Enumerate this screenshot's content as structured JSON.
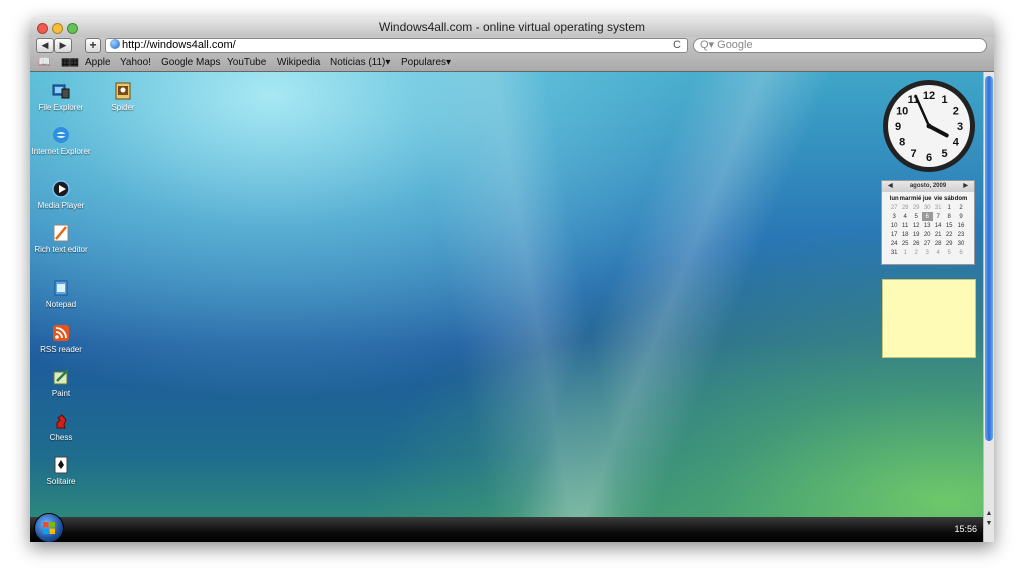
{
  "window": {
    "title": "Windows4all.com - online virtual operating system"
  },
  "toolbar": {
    "back_label": "◀",
    "forward_label": "▶",
    "add_label": "+",
    "url": "http://windows4all.com/",
    "reload_label": "C",
    "search_placeholder": "Q▾ Google"
  },
  "bookmarks": {
    "items": [
      "Apple",
      "Yahoo!",
      "Google Maps",
      "YouTube",
      "Wikipedia",
      "Noticias (11)▾",
      "Populares▾"
    ]
  },
  "desktop": {
    "icons": [
      {
        "label": "File Explorer",
        "icon": "file-explorer-icon"
      },
      {
        "label": "Spider",
        "icon": "spider-solitaire-icon"
      },
      {
        "label": "Internet Explorer",
        "icon": "internet-explorer-icon"
      },
      {
        "label": "Media Player",
        "icon": "media-player-icon"
      },
      {
        "label": "Rich text editor",
        "icon": "rich-text-editor-icon"
      },
      {
        "label": "Notepad",
        "icon": "notepad-icon"
      },
      {
        "label": "RSS reader",
        "icon": "rss-icon"
      },
      {
        "label": "Paint",
        "icon": "paint-icon"
      },
      {
        "label": "Chess",
        "icon": "chess-icon"
      },
      {
        "label": "Solitaire",
        "icon": "solitaire-icon"
      }
    ]
  },
  "clock": {
    "numbers": [
      "12",
      "1",
      "2",
      "3",
      "4",
      "5",
      "6",
      "7",
      "8",
      "9",
      "10",
      "11"
    ],
    "hour": 3,
    "minute": 56
  },
  "calendar": {
    "prev_label": "◀",
    "next_label": "▶",
    "month_title": "agosto, 2009",
    "weekdays": [
      "lun",
      "mar",
      "mié",
      "jue",
      "vie",
      "sáb",
      "dom"
    ],
    "weeks": [
      [
        "27",
        "28",
        "29",
        "30",
        "31",
        "1",
        "2"
      ],
      [
        "3",
        "4",
        "5",
        "6",
        "7",
        "8",
        "9"
      ],
      [
        "10",
        "11",
        "12",
        "13",
        "14",
        "15",
        "16"
      ],
      [
        "17",
        "18",
        "19",
        "20",
        "21",
        "22",
        "23"
      ],
      [
        "24",
        "25",
        "26",
        "27",
        "28",
        "29",
        "30"
      ],
      [
        "31",
        "1",
        "2",
        "3",
        "4",
        "5",
        "6"
      ]
    ],
    "today": "6"
  },
  "taskbar": {
    "time": "15:56"
  },
  "colors": {
    "note": "#fdfbb6",
    "scroll_thumb": "#2f6fd8",
    "taskbar": "#0c0c0c"
  }
}
